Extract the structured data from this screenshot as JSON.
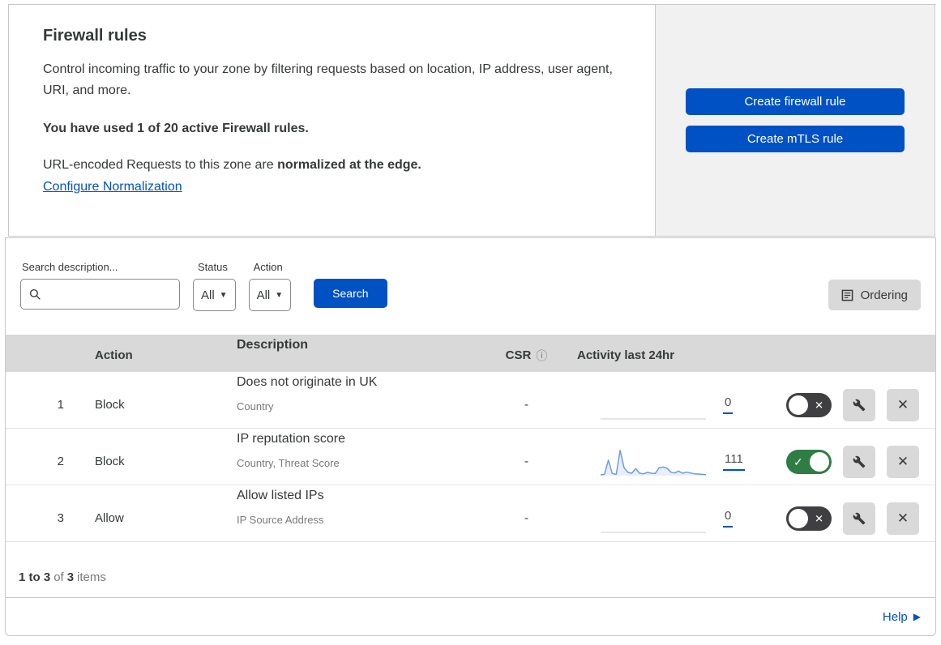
{
  "header": {
    "title": "Firewall rules",
    "description": "Control incoming traffic to your zone by filtering requests based on location, IP address, user agent, URI, and more.",
    "usage": "You have used 1 of 20 active Firewall rules.",
    "normalization_prefix": "URL-encoded Requests to this zone are ",
    "normalization_bold": "normalized at the edge.",
    "normalization_link": "Configure Normalization",
    "buttons": {
      "create_firewall_rule": "Create firewall rule",
      "create_mtls_rule": "Create mTLS rule"
    }
  },
  "filters": {
    "search_label": "Search description...",
    "search_value": "",
    "status_label": "Status",
    "status_value": "All",
    "action_label": "Action",
    "action_value": "All",
    "search_button": "Search",
    "ordering_button": "Ordering"
  },
  "table": {
    "columns": {
      "action": "Action",
      "description": "Description",
      "csr": "CSR",
      "activity": "Activity last 24hr"
    },
    "rows": [
      {
        "number": "1",
        "action": "Block",
        "description": "Does not originate in UK",
        "fields": "Country",
        "csr": "-",
        "activity_count": "0",
        "enabled": false,
        "activity_sparkline": null
      },
      {
        "number": "2",
        "action": "Block",
        "description": "IP reputation score",
        "fields": "Country, Threat Score",
        "csr": "-",
        "activity_count": "111",
        "enabled": true,
        "activity_sparkline": [
          3,
          5,
          58,
          8,
          5,
          95,
          30,
          12,
          9,
          26,
          9,
          7,
          12,
          9,
          8,
          30,
          32,
          28,
          13,
          10,
          17,
          9,
          13,
          10,
          7,
          6,
          5,
          4
        ]
      },
      {
        "number": "3",
        "action": "Allow",
        "description": "Allow listed IPs",
        "fields": "IP Source Address",
        "csr": "-",
        "activity_count": "0",
        "enabled": false,
        "activity_sparkline": null
      }
    ]
  },
  "footer": {
    "range": "1 to 3",
    "of": "of",
    "total": "3",
    "items": "items",
    "help": "Help"
  },
  "colors": {
    "accent_blue": "#0051c3",
    "toggle_on_green": "#2e7d44",
    "toggle_off_dark": "#3f3f42",
    "sparkline_blue": "#6c9de0",
    "sparkline_fill": "#e9effa",
    "flat_line_gray": "#cfcfcf",
    "panel_gray": "#f1f1f1",
    "table_header_gray": "#d9d9d9"
  }
}
